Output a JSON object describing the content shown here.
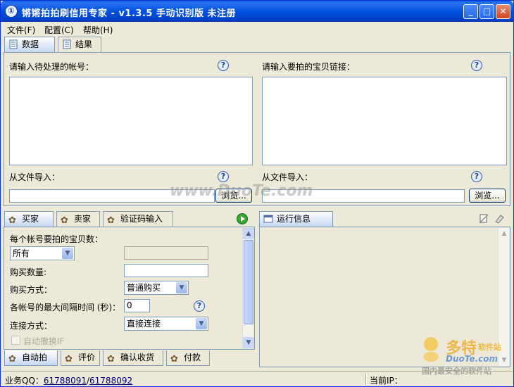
{
  "window": {
    "title": "锵锵拍拍刷信用专家 - v1.3.5 手动识别版 未注册",
    "app_icon_glyph": "①",
    "controls": {
      "minimize": "_",
      "maximize": "□",
      "close": "✕"
    }
  },
  "menu": [
    "文件(F)",
    "配置(C)",
    "帮助(H)"
  ],
  "top_tabs": [
    {
      "label": "数据",
      "icon": "document-icon",
      "active": true
    },
    {
      "label": "结果",
      "icon": "document-icon",
      "active": false
    }
  ],
  "data_tab": {
    "accounts_label": "请输入待处理的帐号：",
    "accounts_value": "",
    "items_label": "请输入要拍的宝贝链接：",
    "items_value": "",
    "import_left_label": "从文件导入：",
    "import_left_path": "",
    "import_right_label": "从文件导入：",
    "import_right_path": "",
    "browse_left": "浏览...",
    "browse_right": "浏览..."
  },
  "lower_left_tabs": [
    {
      "label": "买家",
      "icon": "gear-icon",
      "active": true
    },
    {
      "label": "卖家",
      "icon": "gear-icon",
      "active": false
    },
    {
      "label": "验证码输入",
      "icon": "gear-icon",
      "active": false
    }
  ],
  "buyer": {
    "items_per_account_label": "每个帐号要拍的宝贝数：",
    "items_per_account_select": "所有",
    "items_per_account_value": "",
    "quantity_label": "购买数量:",
    "quantity_value": "",
    "buy_method_label": "购买方式：",
    "buy_method_value": "普通购买",
    "max_interval_label": "各帐号的最大间隔时间 (秒)：",
    "max_interval_value": "0",
    "connect_label": "连接方式：",
    "connect_value": "直接连接",
    "auto_switch_ip_label": "自动撒换IF",
    "auto_switch_ip_checked": false
  },
  "bottom_tabs": [
    {
      "label": "自动拍",
      "icon": "gear-icon",
      "active": true
    },
    {
      "label": "评价",
      "icon": "gear-icon",
      "active": false
    },
    {
      "label": "确认收货",
      "icon": "gear-icon",
      "active": false
    },
    {
      "label": "付款",
      "icon": "gear-icon",
      "active": false
    }
  ],
  "run_info": {
    "title": "运行信息",
    "content": ""
  },
  "statusbar": {
    "business_qq_label": "业务QQ：",
    "qq1": "61788091",
    "separator": "/",
    "qq2": "61788092",
    "current_ip_label": "当前IP："
  },
  "watermarks": {
    "center": "www.DuoTe.com",
    "brand_cn": "多特",
    "brand_suffix": "软件站",
    "brand_url": "DuoTe.com",
    "brand_tagline": "国内最安全的软件站"
  },
  "colors": {
    "titlebar": "#0050e0",
    "window_bg": "#ece9d8",
    "active_tab": "#c7d8f3",
    "play_button": "#2fa82f"
  }
}
